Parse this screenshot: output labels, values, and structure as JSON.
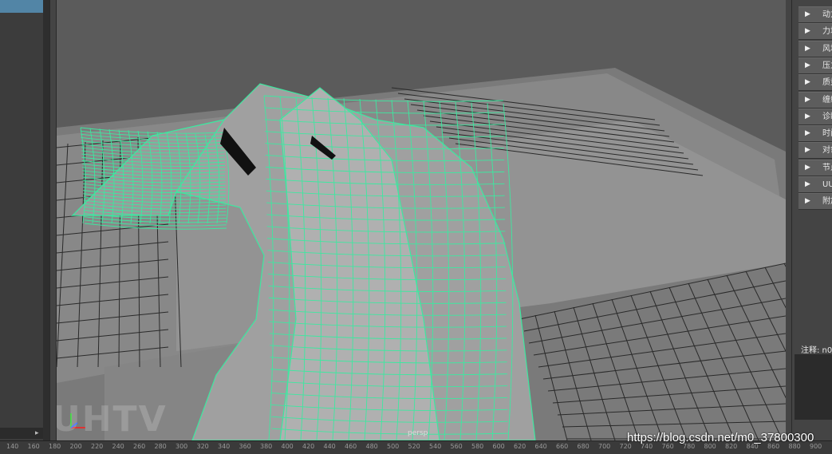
{
  "viewport": {
    "camera_label": "persp",
    "watermark_text": "UHTV"
  },
  "attribute_sections": [
    {
      "label": "动力"
    },
    {
      "label": "力场"
    },
    {
      "label": "风场"
    },
    {
      "label": "压力"
    },
    {
      "label": "质量"
    },
    {
      "label": "缠绕"
    },
    {
      "label": "诊断"
    },
    {
      "label": "时间"
    },
    {
      "label": "对象"
    },
    {
      "label": "节点"
    },
    {
      "label": "UU"
    },
    {
      "label": "附加"
    }
  ],
  "notes": {
    "label": "注释: n0"
  },
  "timeline": {
    "ticks": [
      "140",
      "160",
      "180",
      "200",
      "220",
      "240",
      "260",
      "280",
      "300",
      "320",
      "340",
      "360",
      "380",
      "400",
      "420",
      "440",
      "460",
      "480",
      "500",
      "520",
      "540",
      "560",
      "580",
      "600",
      "620",
      "640",
      "660",
      "680",
      "700",
      "720",
      "740",
      "760",
      "780",
      "800",
      "820",
      "840",
      "860",
      "880",
      "900"
    ]
  },
  "watermark": {
    "url": "https://blog.csdn.net/m0_37800300"
  },
  "colors": {
    "mesh_wire": "#3de8a0",
    "cloth_fill": "#a0a0a0",
    "ground": "#8a8a8a",
    "grid_line": "#2a2a2a"
  }
}
